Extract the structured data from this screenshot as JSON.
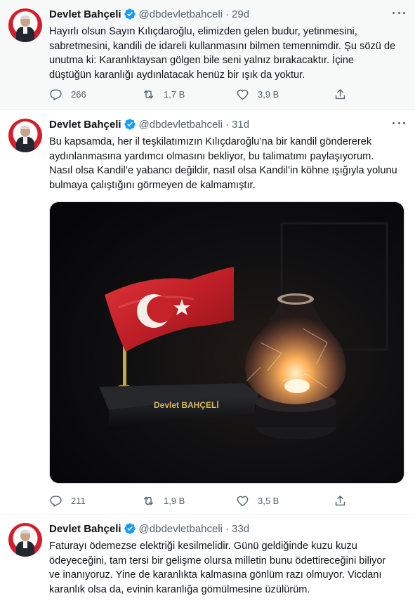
{
  "tweets": [
    {
      "name": "Devlet Bahçeli",
      "handle": "@dbdevletbahceli",
      "separator": "·",
      "time": "29d",
      "lines": [
        "Hayırlı olsun Sayın Kılıçdaroğlu, elimizden gelen budur, yetinmesini,",
        "sabretmesini, kandili de idareli kullanmasını bilmen temennimdir. Şu sözü de",
        "unutma ki: Karanlıktaysan gölgen bile seni yalnız bırakacaktır. İçine",
        "düştüğün karanlığı aydınlatacak henüz bir ışık da yoktur."
      ],
      "replies": "266",
      "retweets": "1,7 B",
      "likes": "3,9 B"
    },
    {
      "name": "Devlet Bahçeli",
      "handle": "@dbdevletbahceli",
      "separator": "·",
      "time": "31d",
      "lines": [
        "Bu kapsamda, her il teşkilatımızın Kılıçdaroğlu’na bir kandil göndererek",
        "aydınlanmasına yardımcı olmasını bekliyor, bu talimatımı paylaşıyorum.",
        "Nasıl olsa Kandil’e yabancı değildir, nasıl olsa Kandil’in köhne ışığıyla yolunu",
        "bulmaya çalıştığını görmeyen de kalmamıştır."
      ],
      "image": {
        "plaque_text": "Devlet BAHÇELİ",
        "flag_color": "#d42a2f",
        "glow_color": "#ffb25a"
      },
      "replies": "211",
      "retweets": "1,9 B",
      "likes": "3,5 B"
    },
    {
      "name": "Devlet Bahçeli",
      "handle": "@dbdevletbahceli",
      "separator": "·",
      "time": "33d",
      "lines": [
        "Faturayı ödemezse elektriği kesilmelidir. Günü geldiğinde kuzu kuzu",
        "ödeyeceğini, tam tersi bir gelişme olursa milletin bunu ödettireceğini biliyor",
        "ve inanıyoruz. Yine de karanlıkta kalmasına gönlüm razı olmuyor. Vicdanı",
        "karanlık olsa da, evinin karanlığa gömülmesine üzülürüm."
      ]
    }
  ],
  "colors": {
    "verified": "#1d9bf0",
    "muted": "#536471",
    "text": "#0f1419"
  },
  "icons": [
    "verified-badge-icon",
    "more-icon",
    "reply-icon",
    "retweet-icon",
    "like-icon",
    "share-icon"
  ]
}
